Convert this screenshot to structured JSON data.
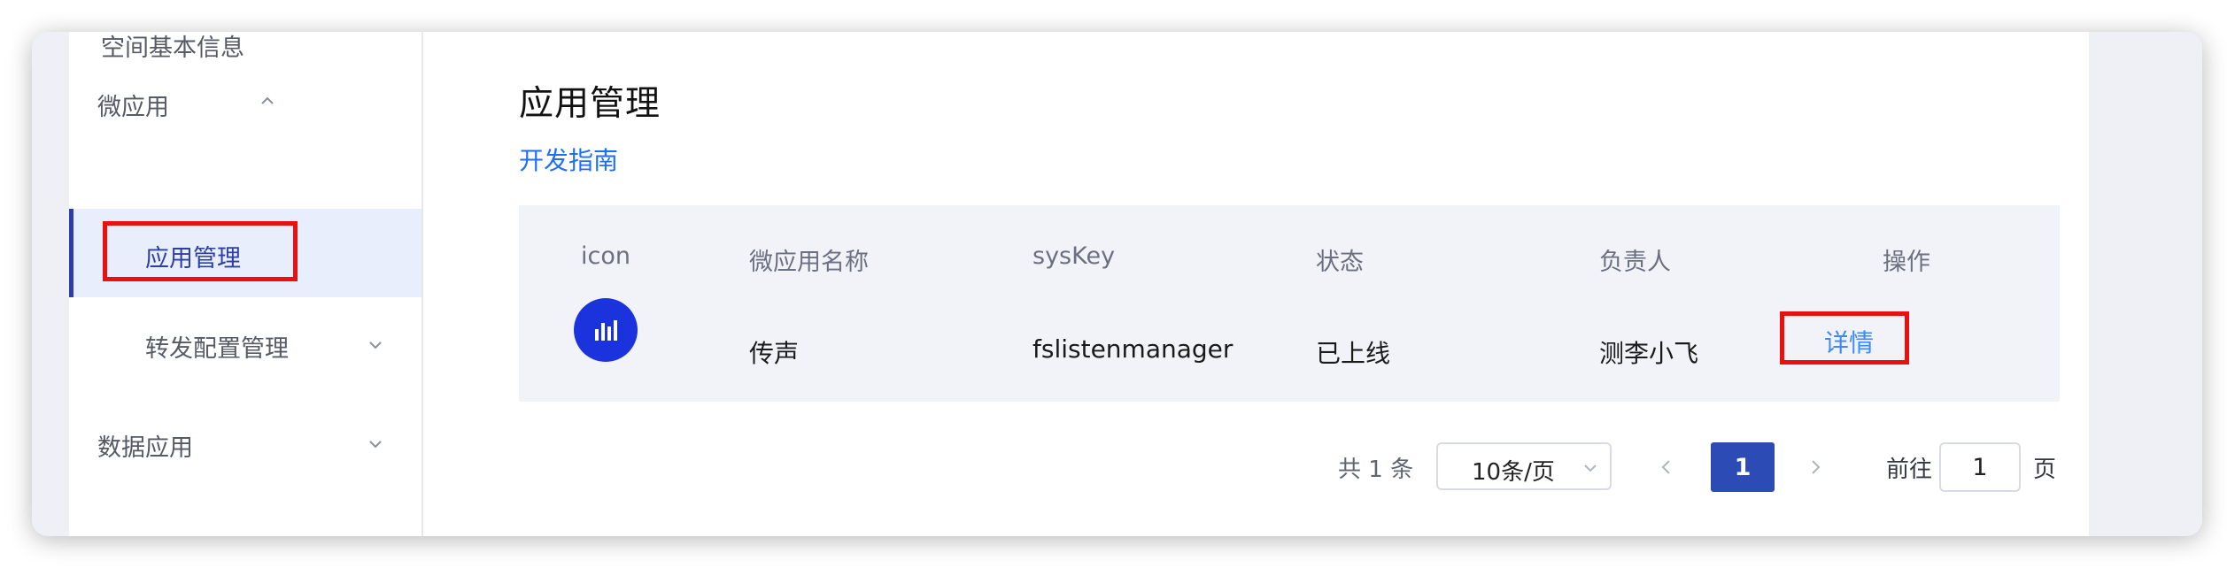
{
  "sidebar": {
    "space_info": "空间基本信息",
    "micro_app": "微应用",
    "app_manage": "应用管理",
    "forward_config": "转发配置管理",
    "data_app": "数据应用"
  },
  "main": {
    "title": "应用管理",
    "guide_link": "开发指南"
  },
  "table": {
    "headers": [
      "icon",
      "微应用名称",
      "sysKey",
      "状态",
      "负责人",
      "操作"
    ],
    "rows": [
      {
        "icon": "bar-chart-icon",
        "name": "传声",
        "syskey": "fslistenmanager",
        "status": "已上线",
        "owner": "测李小飞",
        "action": "详情"
      }
    ]
  },
  "pagination": {
    "total": "共 1 条",
    "page_size": "10条/页",
    "current_page": "1",
    "goto_label": "前往",
    "goto_value": "1",
    "page_unit": "页"
  },
  "colors": {
    "accent": "#2d4bb4",
    "link": "#1e6ff5",
    "highlight": "#ea1010",
    "app_icon_bg": "#1a33dd"
  }
}
